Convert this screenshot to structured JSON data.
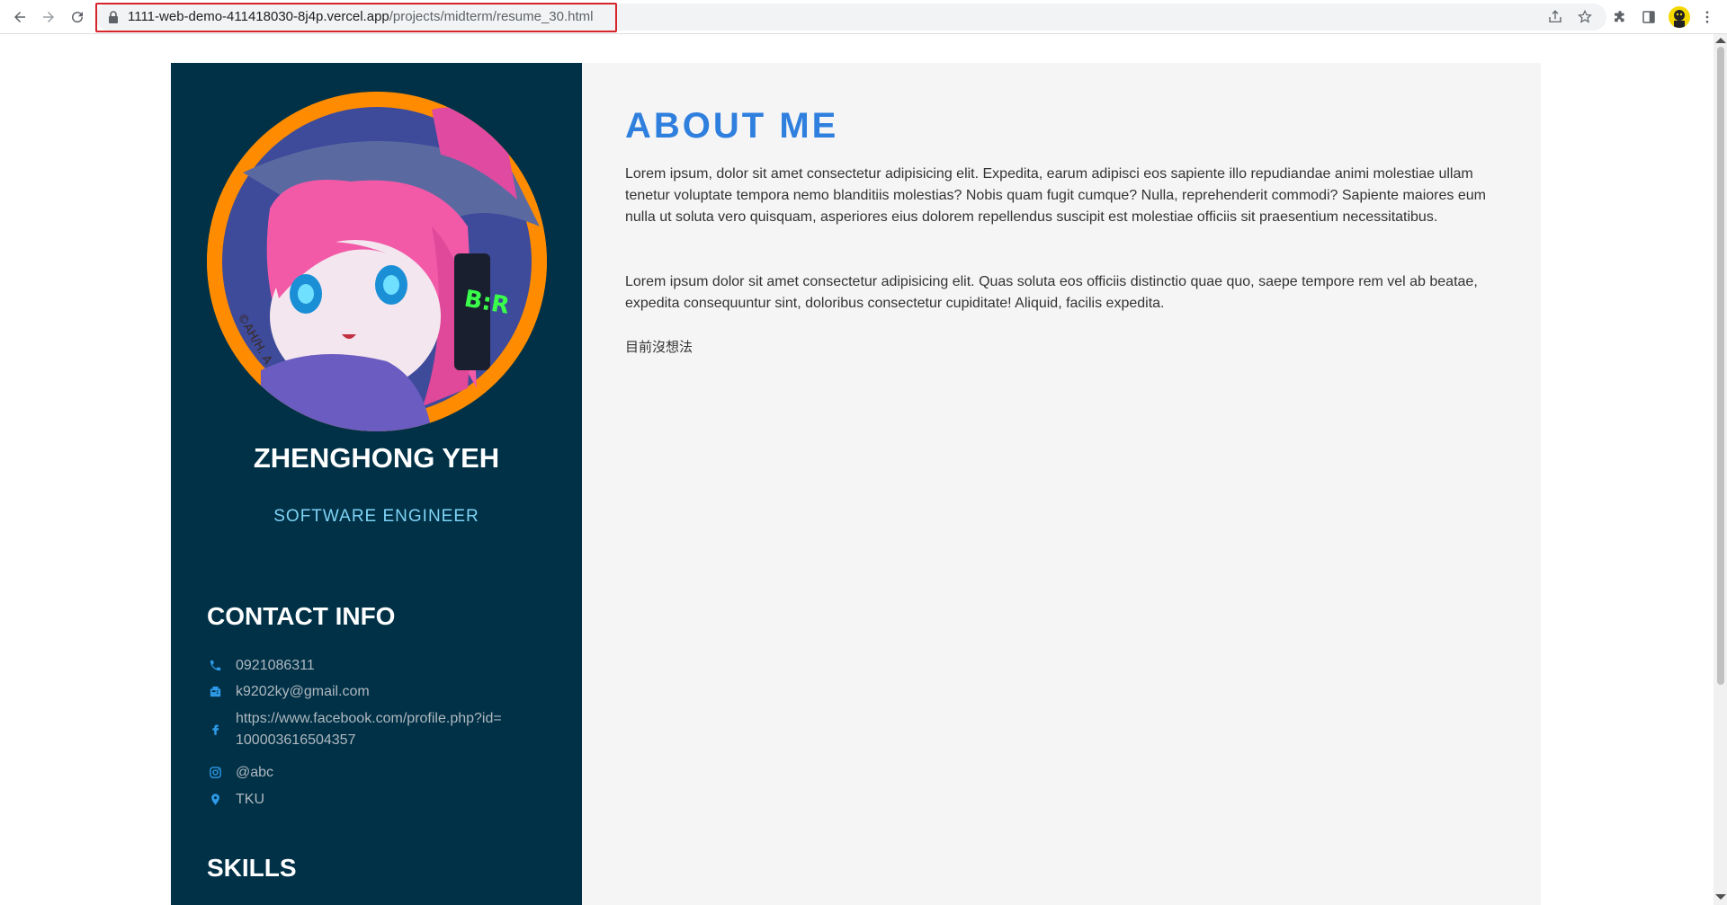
{
  "browser": {
    "url_host": "1111-web-demo-411418030-8j4p.vercel.app",
    "url_path": "/projects/midterm/resume_30.html"
  },
  "profile": {
    "name": "ZHENGHONG YEH",
    "role": "SOFTWARE ENGINEER",
    "avatar_signature": "©AH/H. A"
  },
  "contact": {
    "title": "CONTACT INFO",
    "items": [
      {
        "icon": "phone-icon",
        "text": "0921086311"
      },
      {
        "icon": "fax-icon",
        "text": "k9202ky@gmail.com"
      },
      {
        "icon": "facebook-icon",
        "text": "https://www.facebook.com/profile.php?id=100003616504357"
      },
      {
        "icon": "instagram-icon",
        "text": "@abc"
      },
      {
        "icon": "location-pin-icon",
        "text": "TKU"
      }
    ]
  },
  "skills": {
    "title": "SKILLS"
  },
  "about": {
    "title": "ABOUT ME",
    "paragraphs": [
      "Lorem ipsum, dolor sit amet consectetur adipisicing elit. Expedita, earum adipisci eos sapiente illo repudiandae animi molestiae ullam tenetur voluptate tempora nemo blanditiis molestias? Nobis quam fugit cumque? Nulla, reprehenderit commodi? Sapiente maiores eum nulla ut soluta vero quisquam, asperiores eius dolorem repellendus suscipit est molestiae officiis sit praesentium necessitatibus.",
      "Lorem ipsum dolor sit amet consectetur adipisicing elit. Quas soluta eos officiis distinctio quae quo, saepe tempore rem vel ab beatae, expedita consequuntur sint, doloribus consectetur cupiditate! Aliquid, facilis expedita.",
      "目前沒想法"
    ]
  },
  "colors": {
    "sidebar_bg": "#003147",
    "main_bg": "#f5f5f5",
    "accent_blue": "#2f7fde",
    "role_color": "#7fd3f5",
    "icon_blue": "#2e9ae8"
  }
}
